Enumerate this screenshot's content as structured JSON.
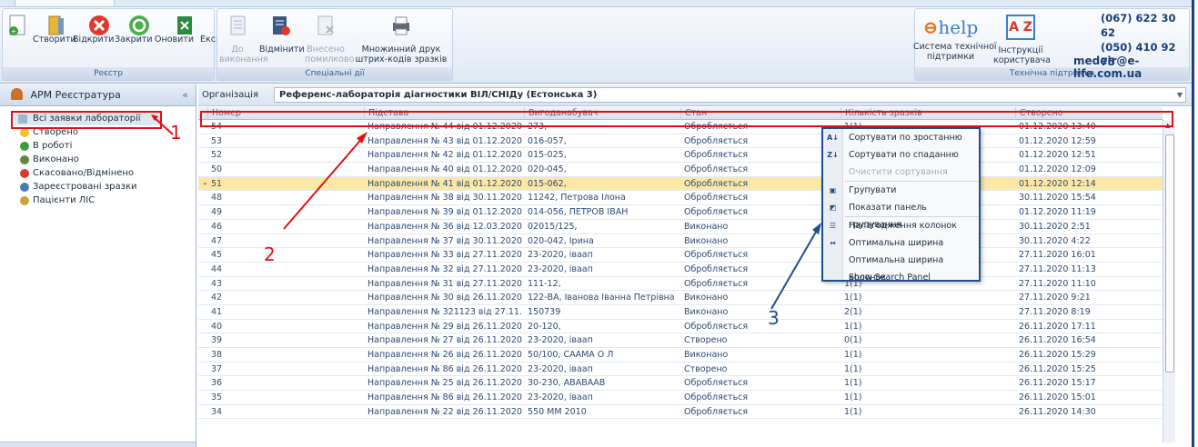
{
  "colors": {
    "accent": "#1f4e8c",
    "annotation_red": "#e01010",
    "selected_row": "#fce8a6"
  },
  "ribbon": {
    "groups": [
      {
        "title": "Реєстр"
      },
      {
        "title": "Спеціальні дії"
      },
      {
        "title": "Технічна підтримка"
      }
    ],
    "registry_buttons": [
      {
        "label": "Створити",
        "icon": "create-icon"
      },
      {
        "label": "Відкрити",
        "icon": "open-folder-icon"
      },
      {
        "label": "Закрити",
        "icon": "close-icon"
      },
      {
        "label": "Оновити",
        "icon": "refresh-icon"
      },
      {
        "label": "Експорт",
        "icon": "export-icon"
      }
    ],
    "special_buttons": [
      {
        "label1": "До",
        "label2": "виконання",
        "disabled": true,
        "icon": "to-execution-icon"
      },
      {
        "label1": "Відмінити",
        "label2": "",
        "disabled": false,
        "icon": "cancel-doc-icon"
      },
      {
        "label1": "Внесено",
        "label2": "помилково",
        "disabled": true,
        "icon": "error-doc-icon"
      },
      {
        "label1": "Множинний друк",
        "label2": "штрих-кодів зразків",
        "disabled": false,
        "icon": "printer-icon"
      }
    ],
    "support": {
      "help_logo": "help",
      "help_label1": "Система технічної",
      "help_label2": "підтримки",
      "az_logo": "A Z",
      "manual_label1": "Інструкції",
      "manual_label2": "користувача",
      "phone1": "(067) 622 30 62",
      "phone2": "(050) 410 92 75",
      "email": "medeir@e-life.com.ua"
    }
  },
  "nav": {
    "title": "АРМ Реєстратура",
    "collapse": "«",
    "items": [
      {
        "label": "Всі заявки лабораторії",
        "icon": "all-requests-icon",
        "color": "#9fb5d2"
      },
      {
        "label": "Створено",
        "icon": "created-status-icon",
        "color": "#f2c32b"
      },
      {
        "label": "В роботі",
        "icon": "in-progress-status-icon",
        "color": "#3c9b3c"
      },
      {
        "label": "Виконано",
        "icon": "done-status-icon",
        "color": "#5a8a3a"
      },
      {
        "label": "Скасовано/Відмінено",
        "icon": "cancelled-status-icon",
        "color": "#d93a2a"
      },
      {
        "label": "Зареєстровані зразки",
        "icon": "samples-icon",
        "color": "#4a78b8"
      },
      {
        "label": "Пацієнти ЛІС",
        "icon": "patients-icon",
        "color": "#c9a43a"
      }
    ],
    "footer_grip": "....."
  },
  "org": {
    "label": "Організація",
    "value": "Референс-лабораторія діагностики ВІЛ/СНІДу (Естонська 3)"
  },
  "grid": {
    "columns": [
      "Номер",
      "Підстава",
      "Вигоданабувач",
      "Стан",
      "Кількість зразків",
      "Створено"
    ],
    "rows": [
      [
        "54",
        "Направлення № 44 від 01.12.2020",
        "273,",
        "Обробляється",
        "1(1)",
        "01.12.2020 13:40"
      ],
      [
        "53",
        "Направлення № 43 від 01.12.2020",
        "016-057,",
        "Обробляється",
        "1(1)",
        "01.12.2020 12:59"
      ],
      [
        "52",
        "Направлення № 42 від 01.12.2020",
        "015-025,",
        "Обробляється",
        "1(1)",
        "01.12.2020 12:51"
      ],
      [
        "50",
        "Направлення № 40 від 01.12.2020",
        "020-045,",
        "Обробляється",
        "1(1)",
        "01.12.2020 12:09"
      ],
      [
        "51",
        "Направлення № 41 від 01.12.2020",
        "015-062,",
        "Обробляється",
        "1(1)",
        "01.12.2020 12:14"
      ],
      [
        "48",
        "Направлення № 38 від 30.11.2020",
        "11242, Петрова Ілона",
        "Обробляється",
        "1(1)",
        "30.11.2020 15:54"
      ],
      [
        "49",
        "Направлення № 39 від 01.12.2020",
        "014-056, ПЕТРОВ ІВАН",
        "Обробляється",
        "1(1)",
        "01.12.2020 11:19"
      ],
      [
        "46",
        "Направлення № 36 від 12.03.2020",
        "02015/125,",
        "Виконано",
        "1(1)",
        "30.11.2020 2:51"
      ],
      [
        "47",
        "Направлення № 37 від 30.11.2020",
        "020-042, Ірина",
        "Виконано",
        "1(1)",
        "30.11.2020 4:22"
      ],
      [
        "45",
        "Направлення № 33 від 27.11.2020",
        "23-2020, іваап",
        "Обробляється",
        "1(1)",
        "27.11.2020 16:01"
      ],
      [
        "44",
        "Направлення № 32 від 27.11.2020",
        "23-2020, іваап",
        "Обробляється",
        "1(1)",
        "27.11.2020 11:13"
      ],
      [
        "43",
        "Направлення № 31 від 27.11.2020",
        "111-12,",
        "Обробляється",
        "1(1)",
        "27.11.2020 11:10"
      ],
      [
        "42",
        "Направлення № 30 від 26.11.2020",
        "122-ВА, Іванова Іванна Петрівна",
        "Виконано",
        "1(1)",
        "27.11.2020 9:21"
      ],
      [
        "41",
        "Направлення № 321123 від 27.11.2...",
        "150739",
        "Виконано",
        "2(1)",
        "27.11.2020 8:19"
      ],
      [
        "40",
        "Направлення № 29 від 26.11.2020",
        "20-120,",
        "Обробляється",
        "1(1)",
        "26.11.2020 17:11"
      ],
      [
        "39",
        "Направлення № 27 від 26.11.2020",
        "23-2020, іваап",
        "Створено",
        "0(1)",
        "26.11.2020 16:54"
      ],
      [
        "38",
        "Направлення № 26 від 26.11.2020",
        "50/100, СААМА О Л",
        "Виконано",
        "1(1)",
        "26.11.2020 15:29"
      ],
      [
        "37",
        "Направлення № 86 від 26.11.2020",
        "23-2020, іваап",
        "Створено",
        "1(1)",
        "26.11.2020 15:25"
      ],
      [
        "36",
        "Направлення № 25 від 26.11.2020",
        "30-230, АВАВААВ",
        "Обробляється",
        "1(1)",
        "26.11.2020 15:17"
      ],
      [
        "35",
        "Направлення № 86 від 26.11.2020",
        "23-2020, іваап",
        "Обробляється",
        "1(1)",
        "26.11.2020 15:01"
      ],
      [
        "34",
        "Направлення № 22 від 26.11.2020",
        "550 ММ 2010",
        "Обробляється",
        "1(1)",
        "26.11.2020 14:30"
      ]
    ],
    "selected_index": 4
  },
  "context_menu": {
    "items": [
      {
        "label": "Сортувати по зростанню",
        "icon": "sort-ascending-icon",
        "glyph": "A↓",
        "disabled": false,
        "sep_before": false
      },
      {
        "label": "Сортувати по спаданню",
        "icon": "sort-descending-icon",
        "glyph": "Z↓",
        "disabled": false,
        "sep_before": false
      },
      {
        "label": "Очистити сортування",
        "icon": "clear-sort-icon",
        "glyph": "",
        "disabled": true,
        "sep_before": false
      },
      {
        "label": "Групувати",
        "icon": "group-icon",
        "glyph": "▣",
        "disabled": false,
        "sep_before": true
      },
      {
        "label": "Показати панель групування",
        "icon": "group-panel-icon",
        "glyph": "◩",
        "disabled": false,
        "sep_before": false
      },
      {
        "label": "Налагодження колонок",
        "icon": "column-chooser-icon",
        "glyph": "☰",
        "disabled": false,
        "sep_before": true
      },
      {
        "label": "Оптимальна ширина",
        "icon": "best-fit-icon",
        "glyph": "↔",
        "disabled": false,
        "sep_before": false
      },
      {
        "label": "Оптимальна ширина колонок",
        "icon": "",
        "glyph": "",
        "disabled": false,
        "sep_before": false
      },
      {
        "label": "Show Search Panel",
        "icon": "",
        "glyph": "",
        "disabled": false,
        "sep_before": false
      }
    ]
  },
  "annotations": {
    "n1": "1",
    "n2": "2",
    "n3": "3"
  }
}
